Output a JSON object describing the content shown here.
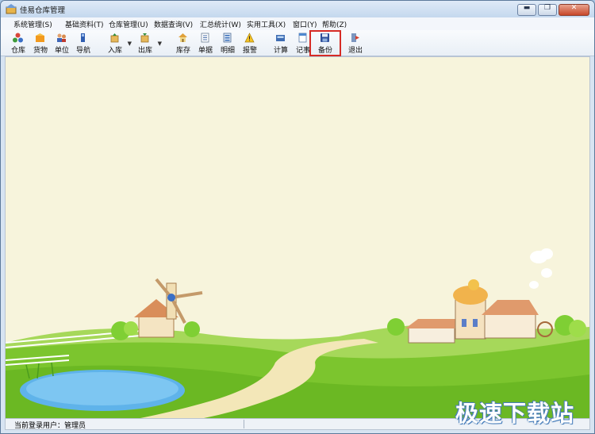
{
  "window": {
    "title": "佳易仓库管理",
    "minimize_glyph": "▬",
    "restore_glyph": "❐",
    "close_glyph": "✕"
  },
  "menu": [
    "系统管理(S)",
    "基础资料(T)",
    "仓库管理(U)",
    "数据查询(V)",
    "汇总统计(W)",
    "实用工具(X)",
    "窗口(Y)",
    "帮助(Z)"
  ],
  "toolbar": [
    {
      "label": "仓库",
      "icon": "warehouse-icon"
    },
    {
      "label": "货物",
      "icon": "goods-icon"
    },
    {
      "label": "单位",
      "icon": "unit-icon"
    },
    {
      "label": "导航",
      "icon": "navigation-icon"
    },
    {
      "label": "入库",
      "icon": "stock-in-icon"
    },
    {
      "label": "出库",
      "icon": "stock-out-icon"
    },
    {
      "label": "库存",
      "icon": "inventory-icon"
    },
    {
      "label": "单据",
      "icon": "documents-icon"
    },
    {
      "label": "明细",
      "icon": "details-icon"
    },
    {
      "label": "报警",
      "icon": "alarm-icon"
    },
    {
      "label": "计算",
      "icon": "calculator-icon"
    },
    {
      "label": "记事",
      "icon": "notes-icon"
    },
    {
      "label": "备份",
      "icon": "backup-icon"
    },
    {
      "label": "退出",
      "icon": "exit-icon"
    }
  ],
  "status": {
    "text": "当前登录用户：管理员"
  },
  "watermark": "极速下载站",
  "colors": {
    "highlight_box": "#d62b25",
    "background_cream": "#f7f4dc",
    "grass": "#7cc52e"
  }
}
